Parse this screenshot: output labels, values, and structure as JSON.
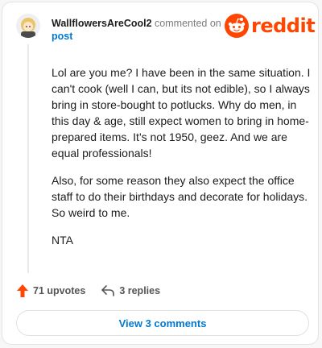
{
  "comment": {
    "username": "WallflowersAreCool2",
    "action_text": "commented on",
    "post_link": "post",
    "paragraphs": [
      "Lol are you me? I have been in the same situation. I can't cook (well I can, but its not edible), so I always bring in store-bought to potlucks. Why do men, in this day & age, still expect women to bring in home-prepared items. It's not 1950, geez. And we are equal professionals!",
      "Also, for some reason they also expect the office staff to do their birthdays and decorate for holidays. So weird to me.",
      "NTA"
    ],
    "upvotes": "71 upvotes",
    "replies": "3 replies",
    "view_comments": "View 3 comments"
  },
  "brand": {
    "logo_text": "reddit",
    "logo_color": "#ff4500",
    "link_color": "#0079d3",
    "upvote_color": "#ff4500"
  },
  "icons": {
    "avatar": "user-avatar",
    "logo": "reddit-snoo-icon",
    "upvote": "upvote-arrow-icon",
    "reply": "reply-arrow-icon"
  }
}
